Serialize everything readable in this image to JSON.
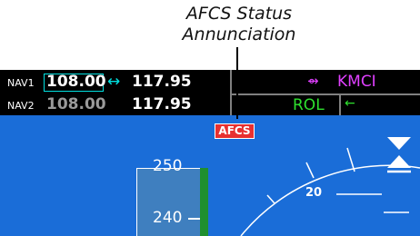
{
  "callout": {
    "line1": "AFCS Status",
    "line2": "Annunciation"
  },
  "nav": {
    "nav1": {
      "label": "NAV1",
      "active": "108.00",
      "swap": "↔",
      "standby": "117.95"
    },
    "nav2": {
      "label": "NAV2",
      "active": "108.00",
      "standby": "117.95"
    }
  },
  "flight_plan": {
    "arrow": "⇴",
    "waypoint": "KMCI"
  },
  "autopilot": {
    "lateral_mode": "ROL",
    "arrow": "←",
    "status": "AFCS"
  },
  "airspeed": {
    "upper_partial": "250",
    "value_240": "240"
  },
  "attitude": {
    "pitch_label": "20"
  },
  "colors": {
    "sky": "#1a6dd8",
    "active_freq": "#ffffff",
    "standby_freq": "#9a9a9a",
    "swap": "#00e0e0",
    "waypoint": "#e040ff",
    "mode": "#2ee02e",
    "afcs_bg": "#e83030"
  }
}
